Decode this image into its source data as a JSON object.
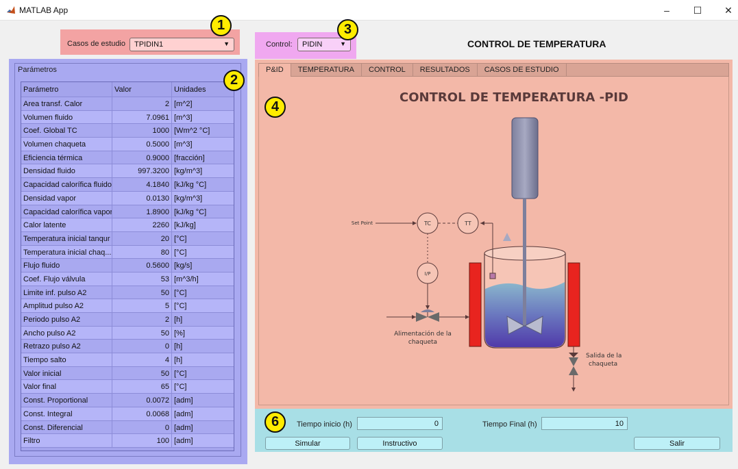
{
  "window": {
    "title": "MATLAB App",
    "minimize": "–",
    "maximize": "☐",
    "close": "✕"
  },
  "badges": [
    "1",
    "2",
    "3",
    "4",
    "6"
  ],
  "case_selector": {
    "label": "Casos de estudio",
    "value": "TPIDIN1"
  },
  "control_selector": {
    "label": "Control:",
    "value": "PIDIN"
  },
  "heading": "CONTROL DE TEMPERATURA",
  "params": {
    "title": "Parámetros",
    "columns": [
      "Parámetro",
      "Valor",
      "Unidades"
    ],
    "rows": [
      [
        "Area transf. Calor",
        "2",
        "[m^2]"
      ],
      [
        "Volumen fluido",
        "7.0961",
        "[m^3]"
      ],
      [
        "Coef. Global TC",
        "1000",
        "[Wm^2 °C]"
      ],
      [
        "Volumen chaqueta",
        "0.5000",
        "[m^3]"
      ],
      [
        "Eficiencia térmica",
        "0.9000",
        "[fracción]"
      ],
      [
        "Densidad fluido",
        "997.3200",
        "[kg/m^3]"
      ],
      [
        "Capacidad calorífica fluido",
        "4.1840",
        "[kJ/kg °C]"
      ],
      [
        "Densidad vapor",
        "0.0130",
        "[kg/m^3]"
      ],
      [
        "Capacidad calorífica vapor",
        "1.8900",
        "[kJ/kg °C]"
      ],
      [
        "Calor latente",
        "2260",
        "[kJ/kg]"
      ],
      [
        "Temperatura inicial tanqur",
        "20",
        "[°C]"
      ],
      [
        "Temperatura inicial chaq...",
        "80",
        "[°C]"
      ],
      [
        "Flujo fluido",
        "0.5600",
        "[kg/s]"
      ],
      [
        "Coef. Flujo válvula",
        "53",
        "[m^3/h]"
      ],
      [
        "Limite inf. pulso A2",
        "50",
        "[°C]"
      ],
      [
        "Amplitud pulso A2",
        "5",
        "[°C]"
      ],
      [
        "Periodo pulso A2",
        "2",
        "[h]"
      ],
      [
        "Ancho pulso A2",
        "50",
        "[%]"
      ],
      [
        "Retrazo pulso A2",
        "0",
        "[h]"
      ],
      [
        "Tiempo salto",
        "4",
        "[h]"
      ],
      [
        "Valor inicial",
        "50",
        "[°C]"
      ],
      [
        "Valor final",
        "65",
        "[°C]"
      ],
      [
        "Const. Proportional",
        "0.0072",
        "[adm]"
      ],
      [
        "Const. Integral",
        "0.0068",
        "[adm]"
      ],
      [
        "Const. Diferencial",
        "0",
        "[adm]"
      ],
      [
        "Filtro",
        "100",
        "[adm]"
      ]
    ]
  },
  "tabs": [
    "P&ID",
    "TEMPERATURA",
    "CONTROL",
    "RESULTADOS",
    "CASOS DE ESTUDIO"
  ],
  "pid": {
    "title": "CONTROL DE TEMPERATURA -PID",
    "set_point": "Set Point",
    "tc": "TC",
    "tt": "TT",
    "ip": "I/P",
    "feed_line1": "Alimentación  de la",
    "feed_line2": "chaqueta",
    "out_line1": "Salida de la",
    "out_line2": "chaqueta"
  },
  "bottom": {
    "t_start_label": "Tiempo inicio (h)",
    "t_start_value": "0",
    "t_end_label": "Tiempo Final (h)",
    "t_end_value": "10",
    "simulate": "Simular",
    "instructions": "Instructivo",
    "exit": "Salir"
  }
}
